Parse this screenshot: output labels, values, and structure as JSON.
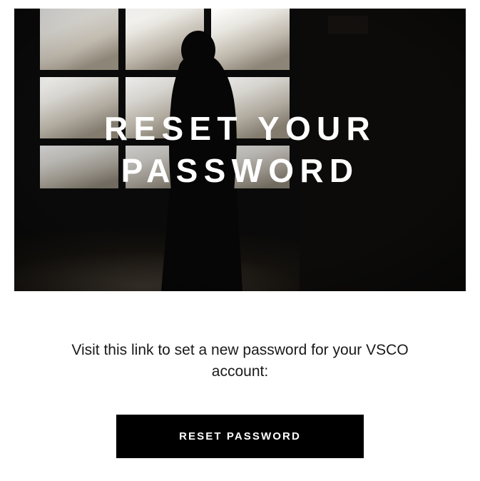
{
  "hero": {
    "title": "RESET YOUR PASSWORD"
  },
  "body": {
    "instruction": "Visit this link to set a new password for your VSCO account:"
  },
  "cta": {
    "label": "RESET PASSWORD"
  },
  "colors": {
    "button_bg": "#000000",
    "button_text": "#ffffff",
    "text": "#1a1a1a",
    "hero_overlay": "#0c0c0c"
  }
}
